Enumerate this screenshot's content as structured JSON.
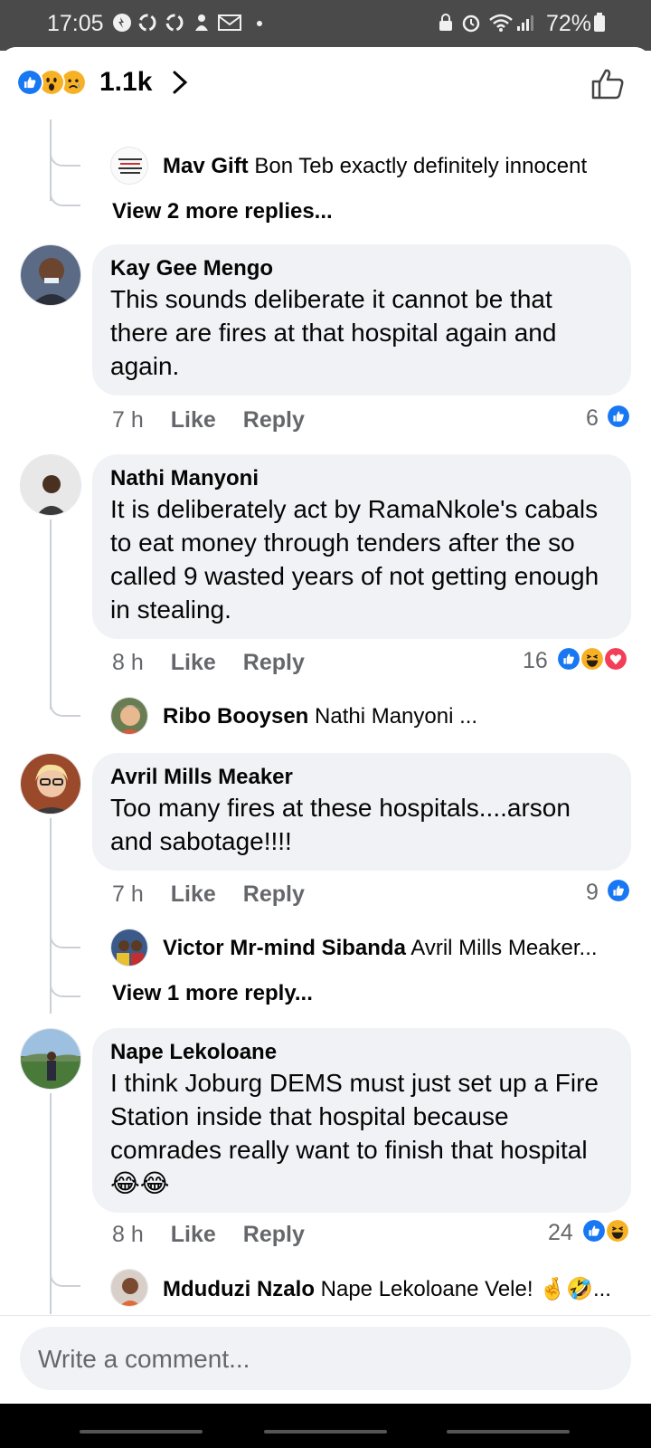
{
  "status_bar": {
    "time": "17:05",
    "battery": "72%",
    "icons": [
      "notification-icon",
      "recycle-icon",
      "recycle-icon",
      "person-icon",
      "gmail-icon",
      "dot-icon",
      "lock-icon",
      "alarm-icon",
      "wifi-icon",
      "signal-icon",
      "battery-icon"
    ]
  },
  "header": {
    "reaction_icons": [
      "like-reaction-icon",
      "wow-reaction-icon",
      "sad-reaction-icon"
    ],
    "reaction_count": "1.1k",
    "like_icon": "thumbs-up-outline-icon"
  },
  "colors": {
    "like_blue": "#1877f2",
    "love_red": "#f33e58",
    "haha_yellow": "#f7b125",
    "bubble_bg": "#f0f2f5",
    "meta_gray": "#65676b"
  },
  "thread": {
    "top_reply": {
      "name": "Mav Gift",
      "text": "Bon Teb exactly definitely innocent"
    },
    "top_more": "View 2 more replies..."
  },
  "comments": [
    {
      "name": "Kay Gee Mengo",
      "text": "This sounds deliberate it cannot be that there are fires at that hospital again and again.",
      "time": "7 h",
      "like_label": "Like",
      "reply_label": "Reply",
      "reaction_count": "6",
      "reactions": [
        "like"
      ]
    },
    {
      "name": "Nathi Manyoni",
      "text": "It is deliberately act by RamaNkole's cabals to eat money through tenders after the so called  9 wasted years of not getting enough in stealing.",
      "time": "8 h",
      "like_label": "Like",
      "reply_label": "Reply",
      "reaction_count": "16",
      "reactions": [
        "like",
        "haha",
        "love"
      ],
      "reply": {
        "name": "Ribo Booysen",
        "text": "Nathi Manyoni ..."
      }
    },
    {
      "name": "Avril Mills Meaker",
      "text": "Too many fires at these hospitals....arson and sabotage!!!!",
      "time": "7 h",
      "like_label": "Like",
      "reply_label": "Reply",
      "reaction_count": "9",
      "reactions": [
        "like"
      ],
      "reply": {
        "name": "Victor Mr-mind Sibanda",
        "text": "Avril Mills Meaker..."
      },
      "more": "View 1 more reply..."
    },
    {
      "name": "Nape Lekoloane",
      "text": "I think Joburg DEMS must just set up a Fire Station inside that hospital because comrades really want to finish that hospital😂😂",
      "time": "8 h",
      "like_label": "Like",
      "reply_label": "Reply",
      "reaction_count": "24",
      "reactions": [
        "like",
        "haha"
      ],
      "reply": {
        "name": "Mduduzi Nzalo",
        "text": "Nape Lekoloane Vele! 🤞🤣..."
      }
    }
  ],
  "composer": {
    "placeholder": "Write a comment..."
  }
}
